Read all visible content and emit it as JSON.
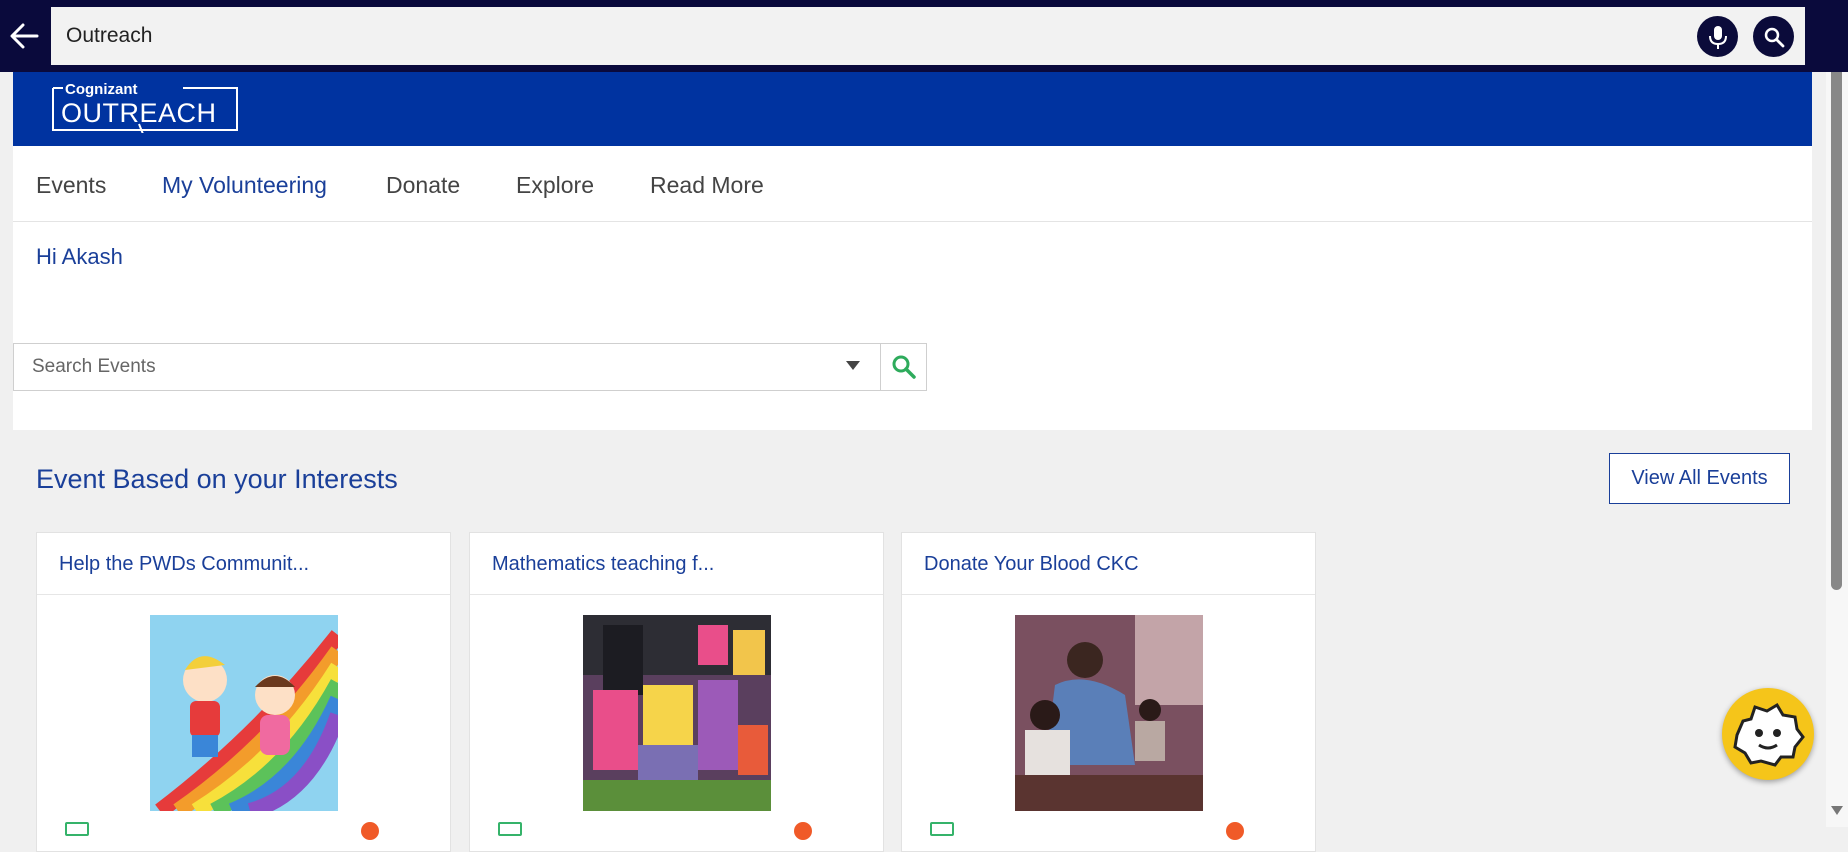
{
  "browser": {
    "search_value": "Outreach"
  },
  "brand": {
    "logo_top": "Cognizant",
    "logo_main": "OUTREACH"
  },
  "nav": {
    "items": [
      {
        "label": "Events",
        "active": false
      },
      {
        "label": "My Volunteering",
        "active": true
      },
      {
        "label": "Donate",
        "active": false
      },
      {
        "label": "Explore",
        "active": false
      },
      {
        "label": "Read More",
        "active": false
      }
    ]
  },
  "hero": {
    "greeting": "Hi Akash",
    "search_placeholder": "Search Events"
  },
  "section": {
    "title": "Event Based on your Interests",
    "view_all_label": "View All Events"
  },
  "events": [
    {
      "title": "Help the PWDs Communit..."
    },
    {
      "title": "Mathematics teaching f..."
    },
    {
      "title": "Donate Your Blood CKC"
    }
  ],
  "colors": {
    "brand_blue": "#0033a0",
    "link_blue": "#1a3f99",
    "topbar": "#0a0a3c",
    "bot_yellow": "#f5c51a"
  }
}
